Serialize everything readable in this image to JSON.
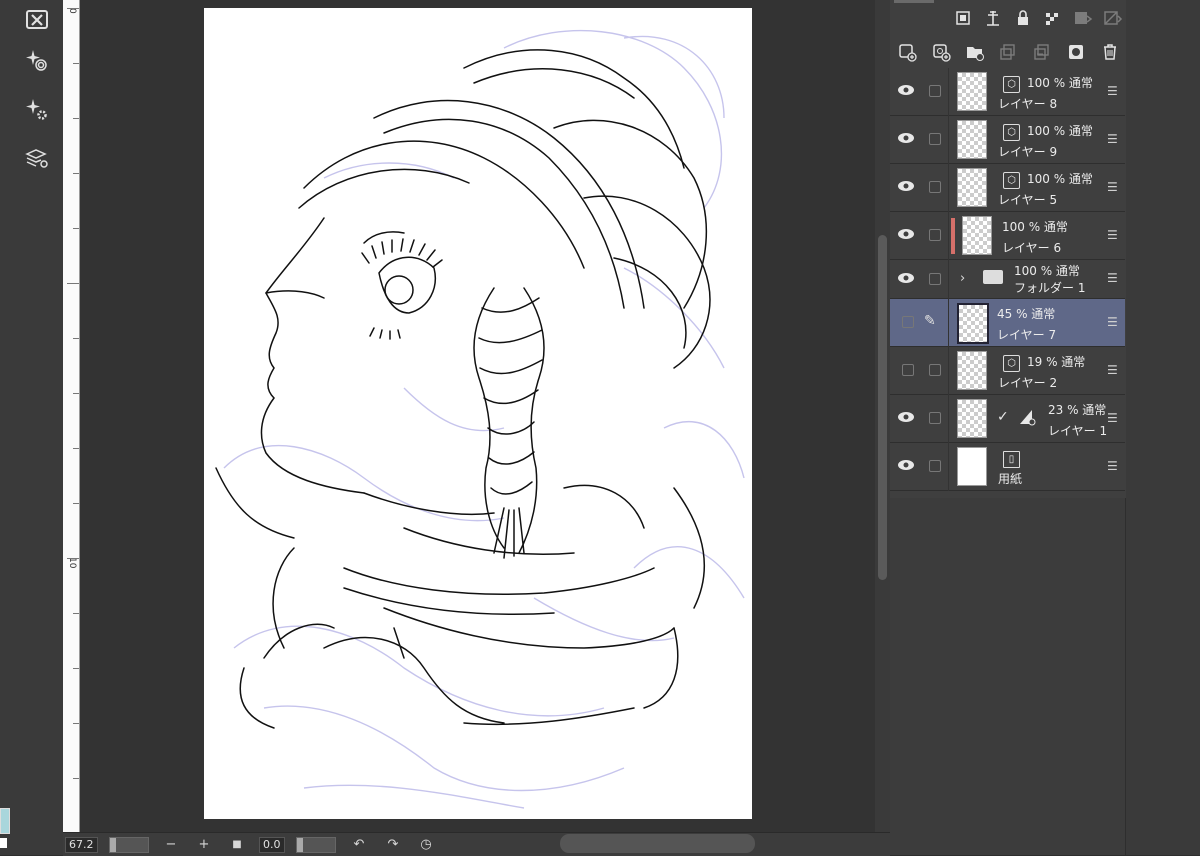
{
  "left_tools": [
    {
      "icon": "close-panel-icon"
    },
    {
      "icon": "sparkle-target-icon"
    },
    {
      "icon": "sparkle-gear-icon"
    },
    {
      "icon": "layer-stack-settings-icon"
    }
  ],
  "ruler": {
    "labels": [
      "0",
      "10"
    ]
  },
  "bottom_bar": {
    "zoom_value": "67.2",
    "zoom_out": "−",
    "zoom_in": "+",
    "fit_icon": "■",
    "rotation_value": "0.0",
    "rotate_left": "↶",
    "rotate_right": "↷",
    "reset_icon": "◷"
  },
  "layer_panel": {
    "toolbar_top": [
      {
        "icon": "layer-ref-icon"
      },
      {
        "icon": "anchor-icon"
      },
      {
        "icon": "lock-icon"
      },
      {
        "icon": "lock-transparency-icon"
      },
      {
        "icon": "clip-icon"
      },
      {
        "icon": "mask-toggle-icon"
      }
    ],
    "toolbar_second": [
      {
        "icon": "new-raster-layer-icon"
      },
      {
        "icon": "new-vector-layer-icon"
      },
      {
        "icon": "new-folder-icon"
      },
      {
        "icon": "merge-down-icon"
      },
      {
        "icon": "merge-selected-icon"
      },
      {
        "icon": "add-mask-icon"
      },
      {
        "icon": "delete-layer-icon"
      }
    ],
    "layers": [
      {
        "opacity_mode": "100 %  通常",
        "name": "レイヤー 8",
        "visible": true,
        "kind": "3d"
      },
      {
        "opacity_mode": "100 %  通常",
        "name": "レイヤー 9",
        "visible": true,
        "kind": "3d"
      },
      {
        "opacity_mode": "100 %  通常",
        "name": "レイヤー 5",
        "visible": true,
        "kind": "3d"
      },
      {
        "opacity_mode": "100 %  通常",
        "name": "レイヤー 6",
        "visible": true,
        "kind": "red"
      },
      {
        "opacity_mode": "100 %  通常",
        "name": "フォルダー 1",
        "visible": true,
        "kind": "folder"
      },
      {
        "opacity_mode": "45 %  通常",
        "name": "レイヤー 7",
        "visible": false,
        "kind": "selected"
      },
      {
        "opacity_mode": "19 %  通常",
        "name": "レイヤー 2",
        "visible": false,
        "kind": "3d"
      },
      {
        "opacity_mode": "23 %  通常",
        "name": "レイヤー 1",
        "visible": true,
        "kind": "masked"
      },
      {
        "opacity_mode": "",
        "name": "用紙",
        "visible": true,
        "kind": "paper"
      }
    ]
  },
  "colors": {
    "accent_selected": "#5f6888",
    "layer_color_tag": "#d6706a",
    "swatch": "#a9d6dc"
  }
}
